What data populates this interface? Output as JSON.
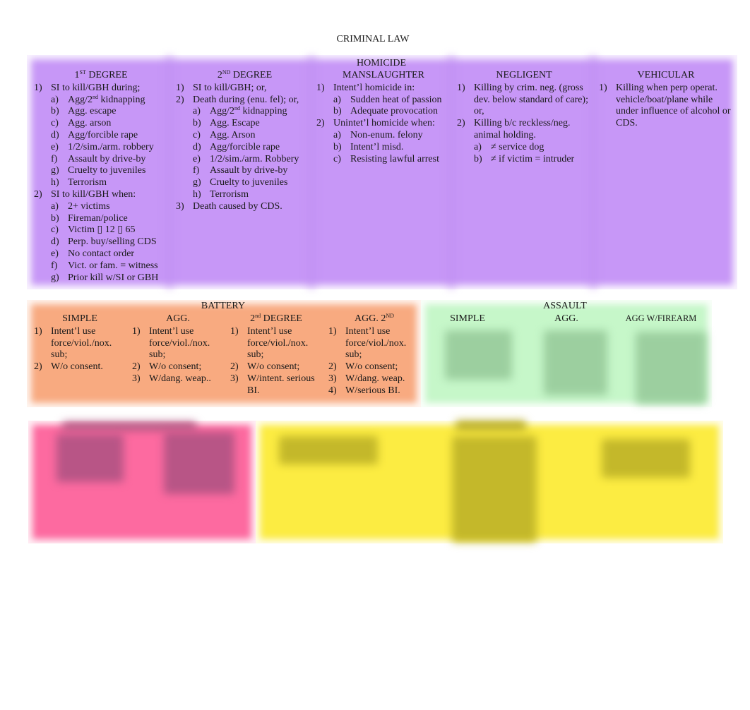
{
  "title": "CRIMINAL LAW",
  "homicide": {
    "header": "HOMICIDE",
    "columns": [
      {
        "heading": "1",
        "heading_sup": "ST",
        "heading_rest": " DEGREE",
        "items": [
          {
            "n": "1)",
            "text": "SI to kill/GBH during;",
            "subs": [
              {
                "n": "a)",
                "text": "Agg/2",
                "sup": "nd",
                "rest": " kidnapping"
              },
              {
                "n": "b)",
                "text": "Agg. escape"
              },
              {
                "n": "c)",
                "text": "Agg. arson"
              },
              {
                "n": "d)",
                "text": "Agg/forcible rape"
              },
              {
                "n": "e)",
                "text": "1/2/sim./arm. robbery"
              },
              {
                "n": "f)",
                "text": "Assault by drive-by"
              },
              {
                "n": "g)",
                "text": "Cruelty to juveniles"
              },
              {
                "n": "h)",
                "text": "Terrorism"
              }
            ]
          },
          {
            "n": "2)",
            "text": "SI to kill/GBH when:",
            "subs": [
              {
                "n": "a)",
                "text": "2+ victims"
              },
              {
                "n": "b)",
                "text": "Fireman/police"
              },
              {
                "n": "c)",
                "text": "Victim ▯ 12 ▯ 65"
              },
              {
                "n": "d)",
                "text": "Perp. buy/selling CDS"
              },
              {
                "n": "e)",
                "text": "No contact order"
              },
              {
                "n": "f)",
                "text": "Vict. or fam. = witness"
              },
              {
                "n": "g)",
                "text": "Prior kill w/SI or GBH"
              }
            ]
          }
        ]
      },
      {
        "heading": "2",
        "heading_sup": "ND",
        "heading_rest": " DEGREE",
        "items": [
          {
            "n": "1)",
            "text": "SI to kill/GBH; or,",
            "subs": []
          },
          {
            "n": "2)",
            "text": "Death during (enu. fel); or,",
            "subs": [
              {
                "n": "a)",
                "text": "Agg/2",
                "sup": "nd",
                "rest": " kidnapping"
              },
              {
                "n": "b)",
                "text": "Agg. Escape"
              },
              {
                "n": "c)",
                "text": "Agg. Arson"
              },
              {
                "n": "d)",
                "text": "Agg/forcible rape"
              },
              {
                "n": "e)",
                "text": "1/2/sim./arm. Robbery"
              },
              {
                "n": "f)",
                "text": "Assault by drive-by"
              },
              {
                "n": "g)",
                "text": "Cruelty to juveniles"
              },
              {
                "n": "h)",
                "text": "Terrorism"
              }
            ]
          },
          {
            "n": "3)",
            "text": "Death caused by CDS.",
            "subs": []
          }
        ]
      },
      {
        "heading": "MANSLAUGHTER",
        "heading_sup": "",
        "heading_rest": "",
        "items": [
          {
            "n": "1)",
            "text": "Intent’l  homicide in:",
            "subs": [
              {
                "n": "a)",
                "text": "Sudden heat of passion"
              },
              {
                "n": "b)",
                "text": "Adequate provocation"
              }
            ]
          },
          {
            "n": "2)",
            "text": "Unintet’l  homicide when:",
            "subs": [
              {
                "n": "a)",
                "text": "Non-enum. felony"
              },
              {
                "n": "b)",
                "text": "Intent’l misd."
              },
              {
                "n": "c)",
                "text": "Resisting lawful arrest"
              }
            ]
          }
        ]
      },
      {
        "heading": "NEGLIGENT",
        "heading_sup": "",
        "heading_rest": "",
        "items": [
          {
            "n": "1)",
            "text": "Killing by crim. neg. (gross dev. below standard of care); or,",
            "subs": []
          },
          {
            "n": "2)",
            "text": "Killing b/c reckless/neg. animal holding.",
            "subs": [
              {
                "n": "a)",
                "text": "≠  service dog"
              },
              {
                "n": "b)",
                "text": "≠  if victim = intruder"
              }
            ]
          }
        ]
      },
      {
        "heading": "VEHICULAR",
        "heading_sup": "",
        "heading_rest": "",
        "items": [
          {
            "n": "1)",
            "text": "Killing when perp operat. vehicle/boat/plane while under influence of alcohol or CDS.",
            "subs": []
          }
        ]
      }
    ]
  },
  "battery": {
    "header": "BATTERY",
    "columns": [
      {
        "heading": "SIMPLE",
        "heading_sup": "",
        "heading_rest": "",
        "items": [
          {
            "n": "1)",
            "text": "Intent’l use force/viol./nox. sub;"
          },
          {
            "n": "2)",
            "text": "W/o consent."
          }
        ]
      },
      {
        "heading": "AGG.",
        "heading_sup": "",
        "heading_rest": "",
        "items": [
          {
            "n": "1)",
            "text": "Intent’l use force/viol./nox. sub;"
          },
          {
            "n": "2)",
            "text": "W/o consent;"
          },
          {
            "n": "3)",
            "text": "W/dang. weap.."
          }
        ]
      },
      {
        "heading": "2",
        "heading_sup": "nd",
        "heading_rest": " DEGREE",
        "items": [
          {
            "n": "1)",
            "text": "Intent’l use force/viol./nox. sub;"
          },
          {
            "n": "2)",
            "text": "W/o consent;"
          },
          {
            "n": "3)",
            "text": "W/intent. serious BI."
          }
        ]
      },
      {
        "heading": "AGG. 2",
        "heading_sup": "ND",
        "heading_rest": "",
        "items": [
          {
            "n": "1)",
            "text": "Intent’l use force/viol./nox. sub;"
          },
          {
            "n": "2)",
            "text": "W/o consent;"
          },
          {
            "n": "3)",
            "text": "W/dang. weap."
          },
          {
            "n": "4)",
            "text": "W/serious BI."
          }
        ]
      }
    ]
  },
  "assault": {
    "header": "ASSAULT",
    "columns": [
      {
        "heading": "SIMPLE"
      },
      {
        "heading": "AGG."
      },
      {
        "heading": "AGG W/FIREARM"
      }
    ]
  },
  "colors": {
    "homicide": "#c797f7",
    "battery": "#f8aa80",
    "assault": "#c6f7c9",
    "pink_section": "#fd6aa0",
    "yellow_section": "#fcec42"
  }
}
